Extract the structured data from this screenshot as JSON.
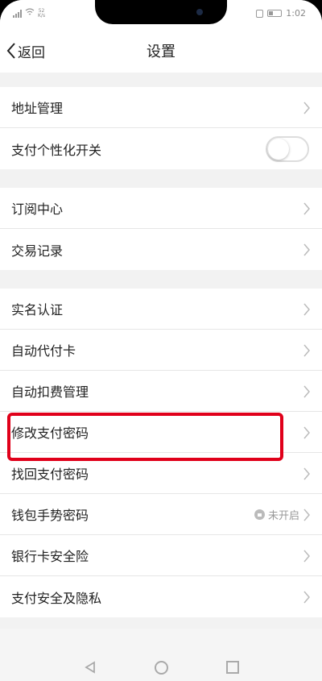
{
  "status_bar": {
    "network_speed": "52",
    "network_speed_unit": "K/s",
    "time": "1:02"
  },
  "nav": {
    "back_label": "返回",
    "title": "设置"
  },
  "groups": [
    {
      "items": [
        {
          "label": "地址管理"
        },
        {
          "label": "支付个性化开关"
        }
      ]
    },
    {
      "items": [
        {
          "label": "订阅中心"
        },
        {
          "label": "交易记录"
        }
      ]
    },
    {
      "items": [
        {
          "label": "实名认证"
        },
        {
          "label": "自动代付卡"
        },
        {
          "label": "自动扣费管理"
        },
        {
          "label": "修改支付密码"
        },
        {
          "label": "找回支付密码"
        },
        {
          "label": "钱包手势密码",
          "badge": "未开启"
        },
        {
          "label": "银行卡安全险"
        },
        {
          "label": "支付安全及隐私"
        }
      ]
    }
  ],
  "toggle_personalized_payment": "off",
  "highlight_color": "#e0001a",
  "icons": [
    "back-chevron-icon",
    "chevron-right-icon",
    "lock-icon",
    "nav-back-icon",
    "nav-home-icon",
    "nav-recent-icon"
  ]
}
